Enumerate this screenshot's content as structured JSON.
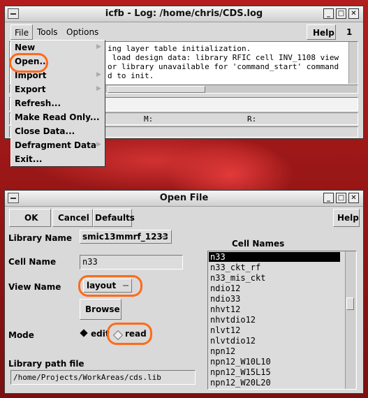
{
  "log_window": {
    "title": "icfb - Log: /home/chris/CDS.log",
    "menu": [
      "File",
      "Tools",
      "Options"
    ],
    "help": "Help",
    "count": "1",
    "log_lines": [
      "ing layer table initialization.",
      " load design data: library RFIC cell INV_1108 view",
      "or library unavailable for 'command_start' command",
      "d to init."
    ],
    "mouse_m": "M:",
    "mouse_r": "R:"
  },
  "file_menu": {
    "items": [
      "New",
      "Open...",
      "Import",
      "Export",
      "Refresh...",
      "Make Read Only...",
      "Close Data...",
      "Defragment Data",
      "Exit..."
    ]
  },
  "open_file": {
    "title": "Open File",
    "ok": "OK",
    "cancel": "Cancel",
    "defaults": "Defaults",
    "help": "Help",
    "library_name_label": "Library Name",
    "library_name": "smic13mmrf_1233",
    "cell_name_label": "Cell Name",
    "cell_name": "n33",
    "view_name_label": "View Name",
    "view_name": "layout",
    "browse": "Browse",
    "mode_label": "Mode",
    "mode_edit": "edit",
    "mode_read": "read",
    "library_path_label": "Library path file",
    "library_path": "/home/Projects/WorkAreas/cds.lib",
    "cell_names_label": "Cell Names",
    "cell_names": [
      "n33",
      "n33_ckt_rf",
      "n33_mis_ckt",
      "ndio12",
      "ndio33",
      "nhvt12",
      "nhvtdio12",
      "nlvt12",
      "nlvtdio12",
      "npn12",
      "npn12_W10L10",
      "npn12_W15L15",
      "npn12_W20L20"
    ]
  },
  "colors": {
    "annotation": "#ff6a1a",
    "selection": "#000000"
  }
}
